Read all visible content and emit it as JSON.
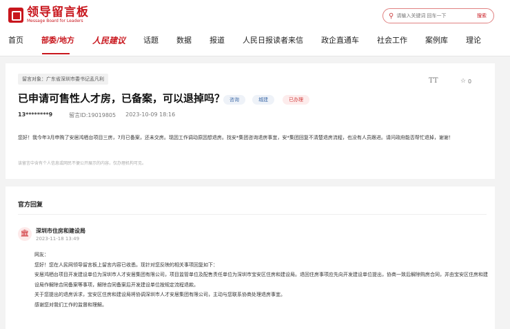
{
  "header": {
    "logo_cn": "领导留言板",
    "logo_en": "Message Board for Leaders",
    "search_placeholder": "请输入关键词 回车一下",
    "search_button": "搜索"
  },
  "nav": [
    "首页",
    "部委/地方",
    "人民建议",
    "话题",
    "数据",
    "报道",
    "人民日报读者来信",
    "政企直通车",
    "社会工作",
    "案例库",
    "理论"
  ],
  "message": {
    "target": "留言对象：广东省深圳市委书记孟凡利",
    "title": "已申请可售性人才房，已备案，可以退掉吗？",
    "tags": [
      "咨询",
      "城建",
      "已办理"
    ],
    "author": "13********9",
    "id": "留言ID:19019805",
    "date": "2023-10-09 18:16",
    "star_count": "0",
    "content": "您好！我今年3月申购了安居鸿栖台项目三房，7月已备案，还未交房。现因工作调动原因想退房。找安*集团咨询退房事宜，安*集团回复不清楚退房流程，也没有人员跟进。请问政府能否帮忙退掉，谢谢！",
    "note": "该留言中含有个人信息或网民不便公开展示的内容，仅办理机构可见。"
  },
  "reply": {
    "heading": "官方回复",
    "org": "深圳市住房和建设局",
    "date": "2023-11-18 13:49",
    "paragraphs": [
      "网友：",
      "您好！您在人民网领导留言板上留言内容已收悉。现针对您反映的相关事项回复如下：",
      "安居鸿栖台项目开发建设单位为深圳市人才安居集团有限公司，项目监管单位及配售责任单位为深圳市宝安区住房和建设局。退回住房事项应先向开发建设单位提出，协商一致后解除购房合同，并由宝安区住房和建设局作解除合同备案等事项，解除合同备案后开发建设单位按规定流程退款。",
      "关于您提出的退房诉求，宝安区住房和建设局将协调深圳市人才安居集团有限公司，主动与您联系协商处理退房事宜。",
      "感谢您对我们工作的监督和理解。"
    ]
  }
}
